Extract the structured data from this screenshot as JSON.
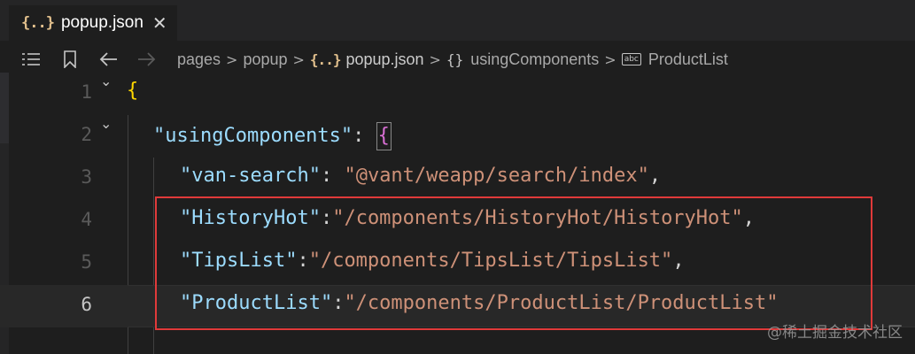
{
  "tab": {
    "icon": "{..}",
    "label": "popup.json",
    "close": "✕"
  },
  "toolbar": {
    "icons": [
      "list-icon",
      "bookmark-icon",
      "arrow-left-icon",
      "arrow-right-icon"
    ]
  },
  "breadcrumb": {
    "items": [
      "pages",
      "popup",
      "popup.json",
      "usingComponents",
      "ProductList"
    ],
    "separator": ">",
    "json_icon": "{..}",
    "object_icon": "{}",
    "string_icon": "abc"
  },
  "editor": {
    "active_line": 6,
    "lines": [
      {
        "num": "1",
        "fold": "⌄",
        "tokens": [
          {
            "t": "{",
            "c": "brace-yellow"
          }
        ]
      },
      {
        "num": "2",
        "fold": "⌄",
        "tokens": [
          {
            "t": "\"usingComponents\"",
            "c": "key"
          },
          {
            "t": ": ",
            "c": "punct"
          },
          {
            "t": "{",
            "c": "brace-purple"
          }
        ]
      },
      {
        "num": "3",
        "tokens": [
          {
            "t": "\"van-search\"",
            "c": "key"
          },
          {
            "t": ": ",
            "c": "punct"
          },
          {
            "t": "\"@vant/weapp/search/index\"",
            "c": "str"
          },
          {
            "t": ",",
            "c": "punct"
          }
        ]
      },
      {
        "num": "4",
        "tokens": [
          {
            "t": "\"HistoryHot\"",
            "c": "key"
          },
          {
            "t": ":",
            "c": "punct"
          },
          {
            "t": "\"/components/HistoryHot/HistoryHot\"",
            "c": "str"
          },
          {
            "t": ",",
            "c": "punct"
          }
        ]
      },
      {
        "num": "5",
        "tokens": [
          {
            "t": "\"TipsList\"",
            "c": "key"
          },
          {
            "t": ":",
            "c": "punct"
          },
          {
            "t": "\"/components/TipsList/TipsList\"",
            "c": "str"
          },
          {
            "t": ",",
            "c": "punct"
          }
        ]
      },
      {
        "num": "6",
        "tokens": [
          {
            "t": "\"ProductList\"",
            "c": "key"
          },
          {
            "t": ":",
            "c": "punct"
          },
          {
            "t": "\"/components/ProductList/ProductList\"",
            "c": "str"
          }
        ]
      }
    ]
  },
  "colors": {
    "key": "#9cdcfe",
    "string": "#ce9178",
    "brace_level1": "#ffd700",
    "brace_level2": "#da70d6",
    "highlight_box": "#e03a3a"
  },
  "watermark": "@稀土掘金技术社区"
}
